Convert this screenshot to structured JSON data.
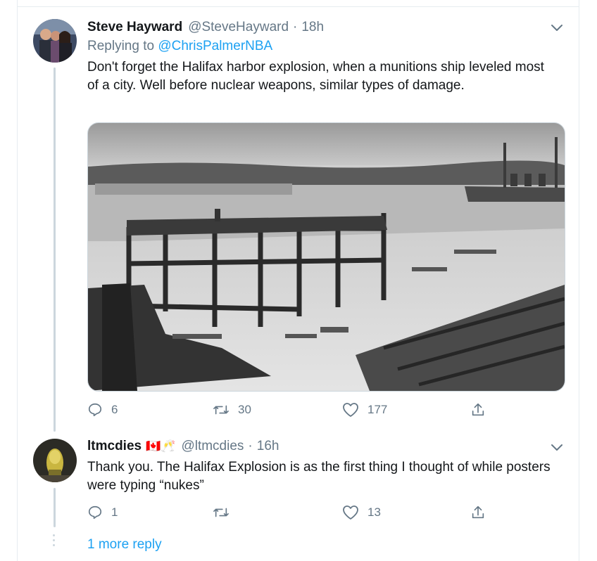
{
  "tweets": [
    {
      "name": "Steve Hayward",
      "handle": "@SteveHayward",
      "time": "18h",
      "replying_label": "Replying to",
      "replying_to": "@ChrisPalmerNBA",
      "text": "Don't forget the Halifax harbor explosion, when a munitions ship leveled most of a city. Well before nuclear weapons, similar types of damage.",
      "replies": "6",
      "retweets": "30",
      "likes": "177"
    },
    {
      "name": "ltmcdies",
      "flags": "🇨🇦🥂",
      "handle": "@ltmcdies",
      "time": "16h",
      "text": "Thank you. The Halifax Explosion is as the first thing I thought of while posters were typing “nukes”",
      "replies": "1",
      "retweets": "",
      "likes": "13"
    }
  ],
  "separator": "·",
  "more_replies": "1 more reply",
  "icons": [
    "reply-icon",
    "retweet-icon",
    "like-icon",
    "share-icon",
    "chevron-down-icon"
  ],
  "colors": {
    "accent": "#1da1f2",
    "muted": "#657786",
    "border": "#e6ecf0"
  }
}
